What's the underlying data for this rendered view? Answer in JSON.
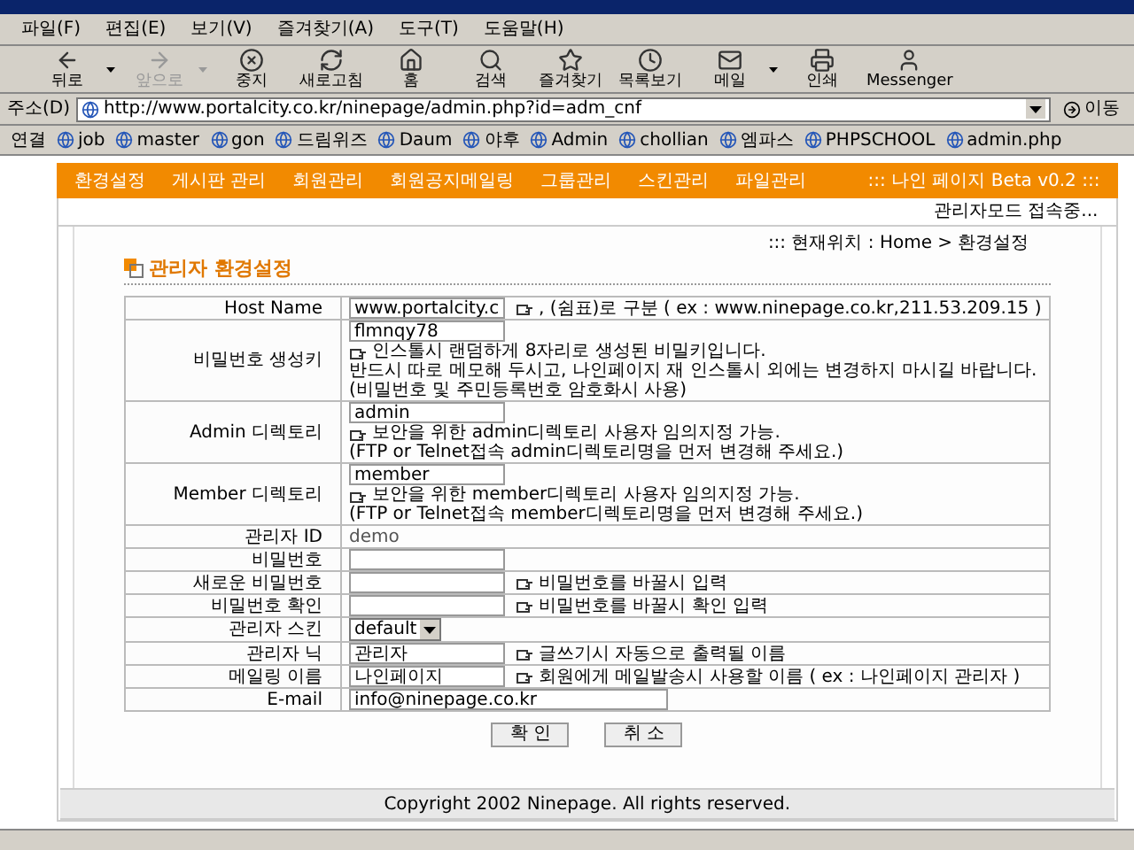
{
  "menu_bar": {
    "items": [
      "파일(F)",
      "편집(E)",
      "보기(V)",
      "즐겨찾기(A)",
      "도구(T)",
      "도움말(H)"
    ]
  },
  "toolbar": {
    "buttons": [
      {
        "label": "뒤로",
        "disabled": false,
        "dropdown": true
      },
      {
        "label": "앞으로",
        "disabled": true,
        "dropdown": true
      },
      {
        "label": "중지",
        "disabled": false,
        "dropdown": false
      },
      {
        "label": "새로고침",
        "disabled": false,
        "dropdown": false
      },
      {
        "label": "홈",
        "disabled": false,
        "dropdown": false
      },
      {
        "label": "검색",
        "disabled": false,
        "dropdown": false
      },
      {
        "label": "즐겨찾기",
        "disabled": false,
        "dropdown": false
      },
      {
        "label": "목록보기",
        "disabled": false,
        "dropdown": false
      },
      {
        "label": "메일",
        "disabled": false,
        "dropdown": true
      },
      {
        "label": "인쇄",
        "disabled": false,
        "dropdown": false
      },
      {
        "label": "Messenger",
        "disabled": false,
        "dropdown": false
      }
    ]
  },
  "address_bar": {
    "label": "주소(D)",
    "value": "http://www.portalcity.co.kr/ninepage/admin.php?id=adm_cnf",
    "go": "이동"
  },
  "links_bar": {
    "label": "연결",
    "items": [
      "job",
      "master",
      "gon",
      "드림위즈",
      "Daum",
      "야후",
      "Admin",
      "chollian",
      "엠파스",
      "PHPSCHOOL",
      "admin.php"
    ]
  },
  "nav": {
    "items": [
      "환경설정",
      "게시판 관리",
      "회원관리",
      "회원공지메일링",
      "그룹관리",
      "스킨관리",
      "파일관리"
    ],
    "brand": "::: 나인 페이지 Beta v0.2 :::"
  },
  "login_status": "관리자모드 접속중...",
  "breadcrumb": "::: 현재위치 : Home > 환경설정",
  "heading": "관리자 환경설정",
  "form": {
    "rows": [
      {
        "kind": "field",
        "label": "Host Name",
        "value": "www.portalcity.c",
        "notes": [
          ", (쉼표)로 구분 ( ex : www.ninepage.co.kr,211.53.209.15 )"
        ]
      },
      {
        "kind": "field_block",
        "label": "비밀번호 생성키",
        "value": "flmnqy78",
        "notes": [
          "인스톨시 랜덤하게 8자리로 생성된 비밀키입니다.",
          "반드시 따로 메모해 두시고, 나인페이지 재 인스톨시 외에는 변경하지 마시길 바랍니다.",
          "(비밀번호 및 주민등록번호 암호화시 사용)"
        ]
      },
      {
        "kind": "field_block",
        "label": "Admin 디렉토리",
        "value": "admin",
        "notes": [
          "보안을 위한 admin디렉토리 사용자 임의지정 가능.",
          "(FTP or Telnet접속 admin디렉토리명을 먼저 변경해 주세요.)"
        ]
      },
      {
        "kind": "field_block",
        "label": "Member 디렉토리",
        "value": "member",
        "notes": [
          "보안을 위한 member디렉토리 사용자 임의지정 가능.",
          "(FTP or Telnet접속 member디렉토리명을 먼저 변경해 주세요.)"
        ]
      },
      {
        "kind": "text",
        "label": "관리자 ID",
        "value": "demo"
      },
      {
        "kind": "field",
        "label": "비밀번호"
      },
      {
        "kind": "field",
        "label": "새로운 비밀번호",
        "notes": [
          "비밀번호를 바꿀시 입력"
        ]
      },
      {
        "kind": "field",
        "label": "비밀번호 확인",
        "notes": [
          "비밀번호를 바꿀시 확인 입력"
        ]
      },
      {
        "kind": "select",
        "label": "관리자 스킨",
        "value": "default"
      },
      {
        "kind": "field",
        "label": "관리자 닉",
        "value": "관리자",
        "notes": [
          "글쓰기시 자동으로 출력될 이름"
        ]
      },
      {
        "kind": "field",
        "label": "메일링 이름",
        "value": "나인페이지",
        "notes": [
          "회원에게 메일발송시 사용할 이름 ( ex : 나인페이지 관리자 )"
        ]
      },
      {
        "kind": "field_wide",
        "label": "E-mail",
        "value": "info@ninepage.co.kr"
      }
    ]
  },
  "buttons": [
    "확 인",
    "취 소"
  ],
  "footer": "Copyright 2002 Ninepage. All rights reserved."
}
